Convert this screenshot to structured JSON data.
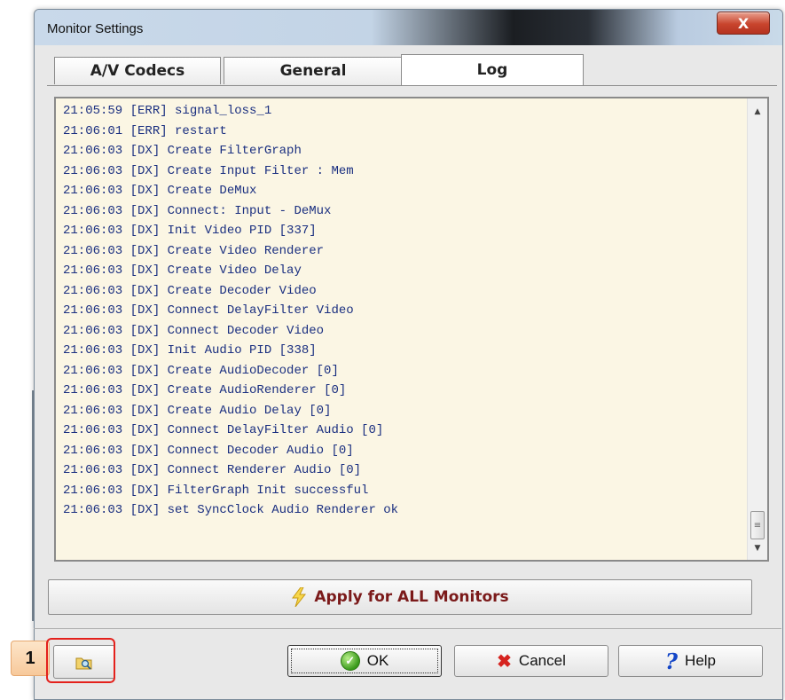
{
  "window": {
    "title": "Monitor Settings",
    "close_glyph": "X"
  },
  "tabs": [
    {
      "label": "A/V Codecs",
      "active": false
    },
    {
      "label": "General",
      "active": false
    },
    {
      "label": "Log",
      "active": true
    }
  ],
  "log": {
    "lines": [
      "21:05:59 [ERR] signal_loss_1",
      "21:06:01 [ERR] restart",
      "21:06:03 [DX] Create FilterGraph",
      "21:06:03 [DX] Create Input Filter : Mem",
      "21:06:03 [DX] Create DeMux",
      "21:06:03 [DX] Connect: Input - DeMux",
      "21:06:03 [DX] Init Video PID [337]",
      "21:06:03 [DX] Create Video Renderer",
      "21:06:03 [DX] Create Video Delay",
      "21:06:03 [DX] Create Decoder Video",
      "21:06:03 [DX] Connect DelayFilter Video",
      "21:06:03 [DX] Connect Decoder Video",
      "21:06:03 [DX] Init Audio PID [338]",
      "21:06:03 [DX] Create AudioDecoder [0]",
      "21:06:03 [DX] Create AudioRenderer [0]",
      "21:06:03 [DX] Create Audio Delay [0]",
      "21:06:03 [DX] Connect DelayFilter Audio [0]",
      "21:06:03 [DX] Connect Decoder Audio [0]",
      "21:06:03 [DX] Connect Renderer Audio [0]",
      "21:06:03 [DX] FilterGraph Init successful",
      "21:06:03 [DX] set SyncClock Audio Renderer ok"
    ]
  },
  "buttons": {
    "apply_all": "Apply for ALL Monitors",
    "ok": "OK",
    "cancel": "Cancel",
    "help": "Help"
  },
  "callout": {
    "number": "1"
  },
  "colors": {
    "log_text": "#1a2f80",
    "log_background": "#fbf6e4",
    "apply_text": "#7b1a1a",
    "highlight": "#e4211c"
  },
  "icons": {
    "apply": "lightning-bolt-icon",
    "ok": "green-check-icon",
    "cancel": "red-x-icon",
    "help": "question-mark-icon",
    "browse": "folder-magnifier-icon"
  }
}
